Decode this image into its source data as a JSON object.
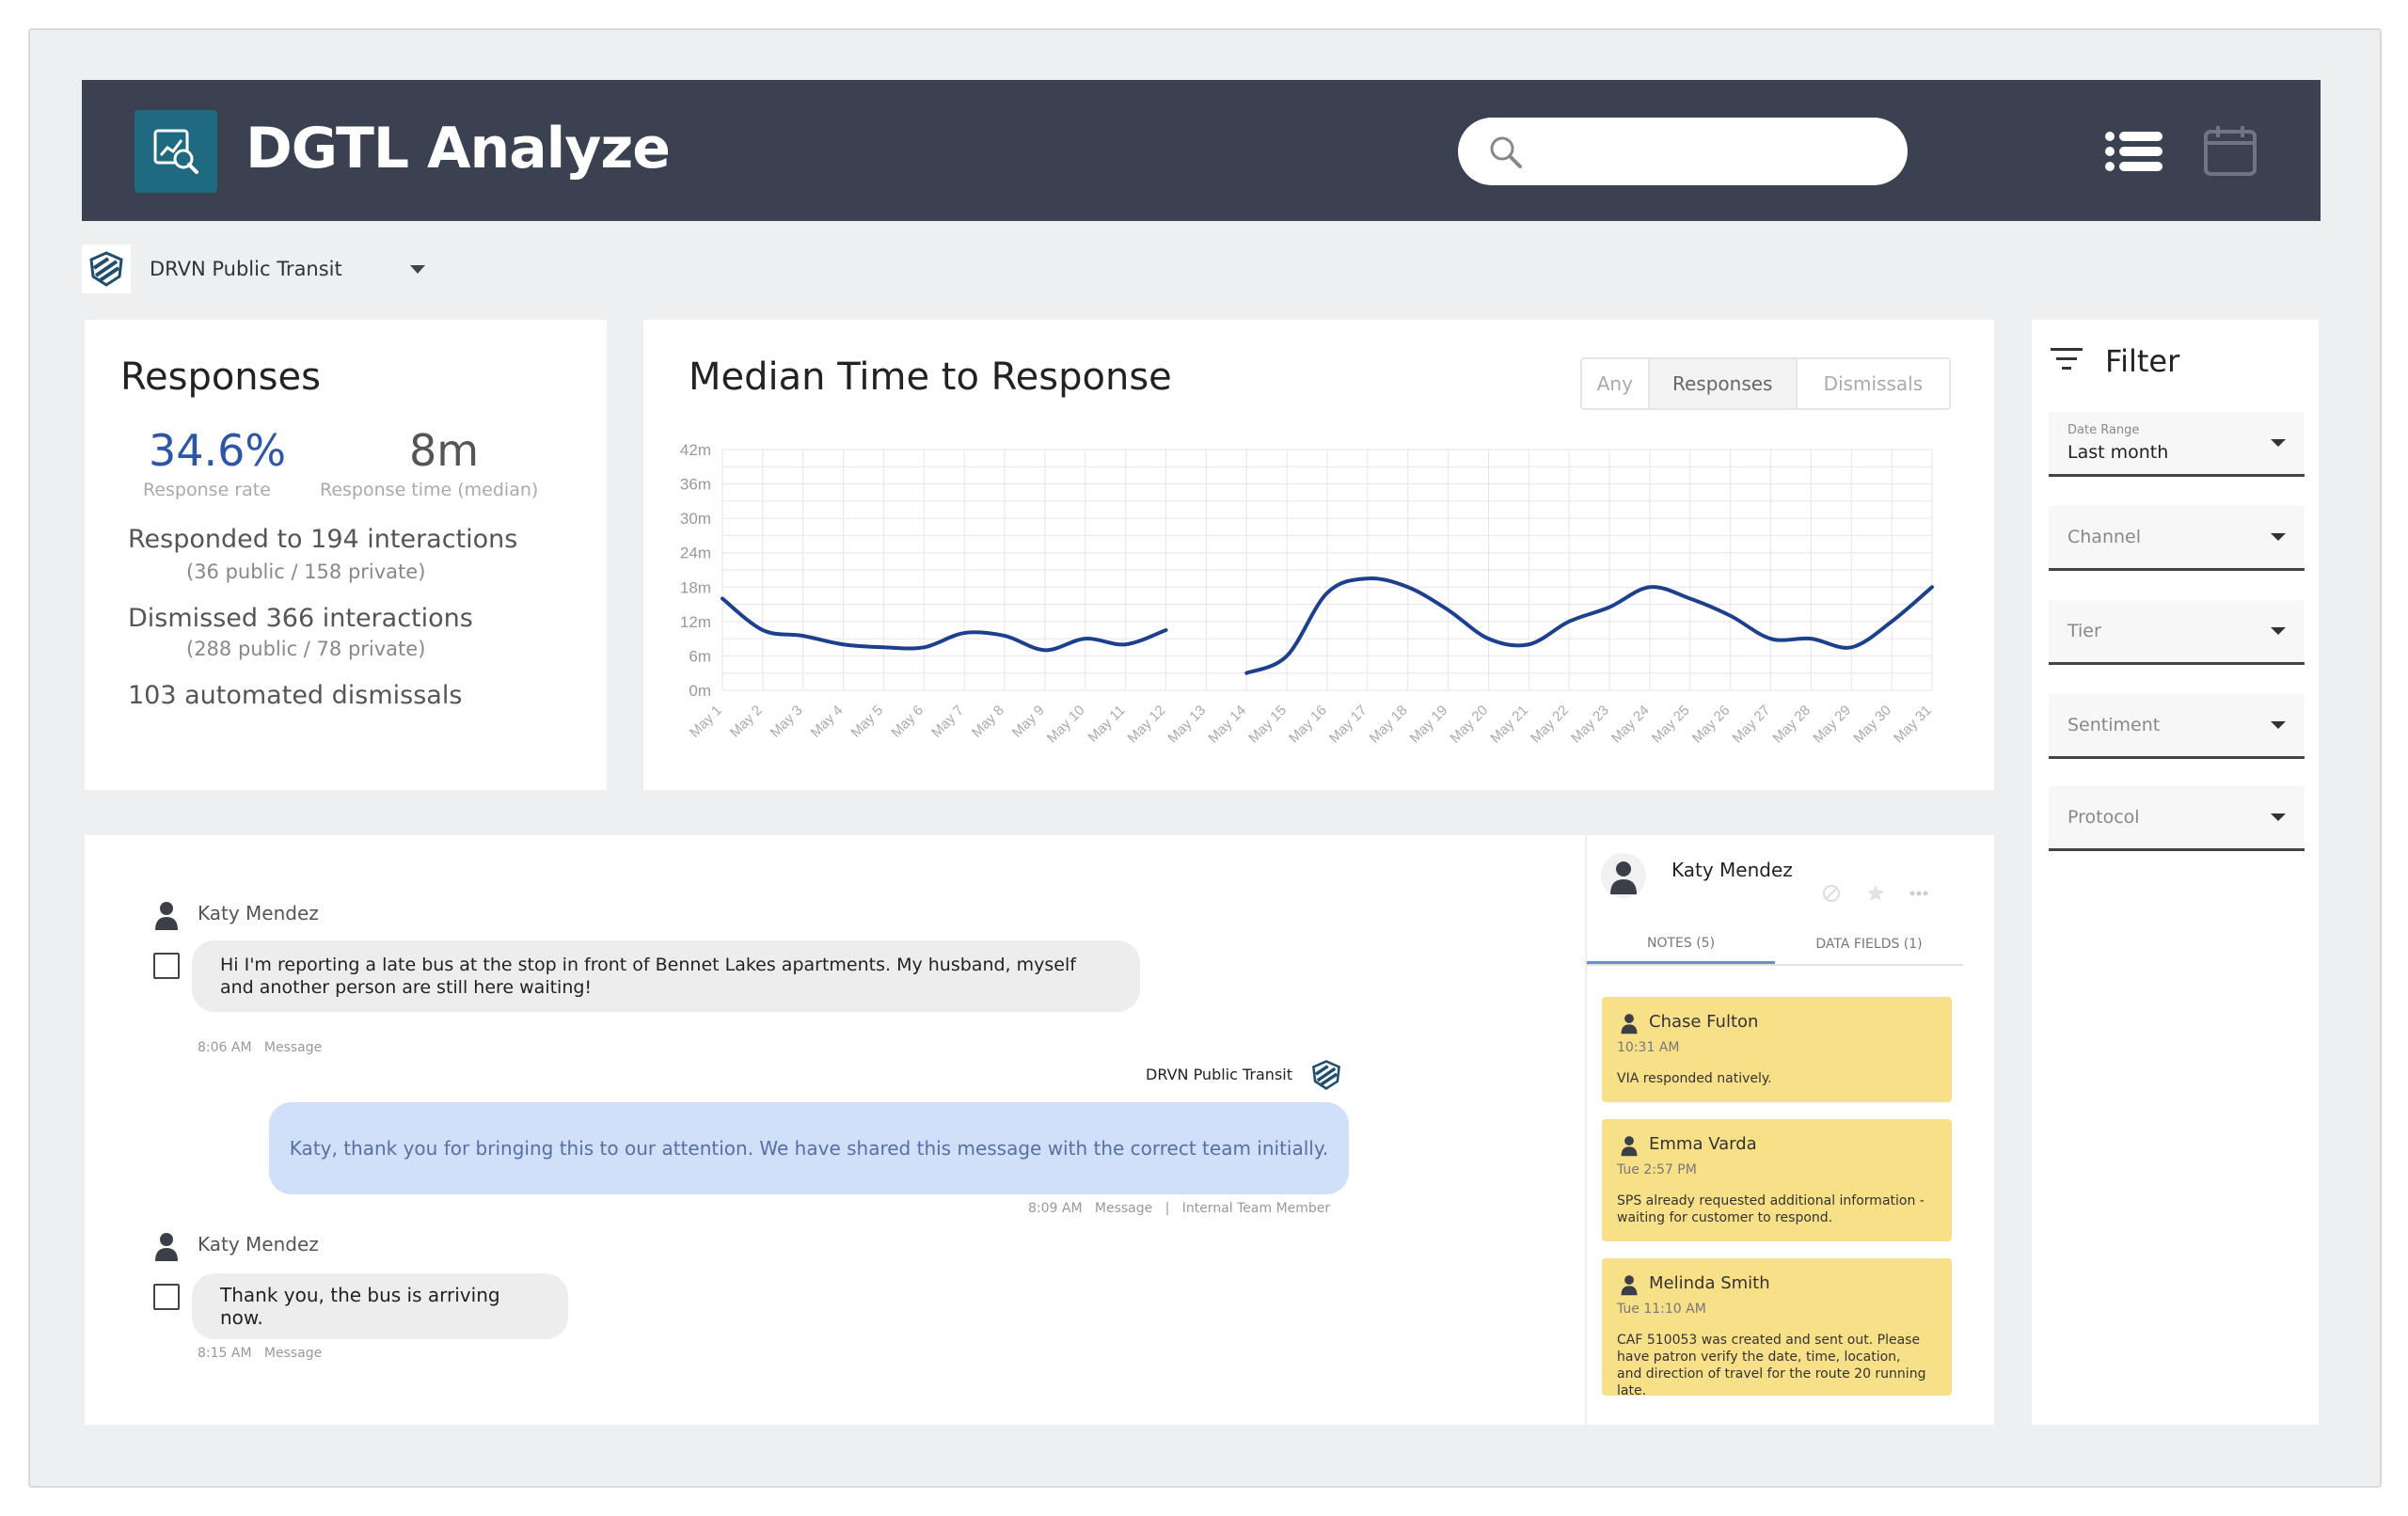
{
  "app": {
    "title": "DGTL Analyze"
  },
  "header": {
    "search": {
      "placeholder": "",
      "value": ""
    }
  },
  "org": {
    "name": "DRVN Public Transit"
  },
  "responses": {
    "title": "Responses",
    "rate_value": "34.6%",
    "rate_label": "Response rate",
    "time_value": "8m",
    "time_label": "Response time (median)",
    "responded": "Responded to 194 interactions",
    "responded_sub": "(36 public / 158 private)",
    "dismissed": "Dismissed 366 interactions",
    "dismissed_sub": "(288 public / 78 private)",
    "automated": "103 automated dismissals",
    "accent": "#2c57a7"
  },
  "median_chart": {
    "title": "Median Time to Response",
    "tabs": [
      "Any",
      "Responses",
      "Dismissals"
    ],
    "active_tab": "Responses"
  },
  "chart_data": {
    "type": "line",
    "title": "Median Time to Response",
    "x": [
      "May 1",
      "May 2",
      "May 3",
      "May 4",
      "May 5",
      "May 6",
      "May 7",
      "May 8",
      "May 9",
      "May 10",
      "May 11",
      "May 12",
      "May 13",
      "May 14",
      "May 15",
      "May 16",
      "May 17",
      "May 18",
      "May 19",
      "May 20",
      "May 21",
      "May 22",
      "May 23",
      "May 24",
      "May 25",
      "May 26",
      "May 27",
      "May 28",
      "May 29",
      "May 30",
      "May 31"
    ],
    "y_ticks": [
      "0m",
      "6m",
      "12m",
      "18m",
      "24m",
      "30m",
      "36m",
      "42m"
    ],
    "ylim": [
      0,
      42
    ],
    "series": [
      {
        "values": [
          16,
          10.5,
          9.5,
          8,
          7.5,
          7.5,
          10,
          9.5,
          7,
          9,
          8,
          10.5,
          null,
          3,
          6,
          17,
          19.5,
          18,
          14,
          9,
          8,
          12,
          14.5,
          18,
          16,
          13,
          9,
          9,
          7.5,
          12,
          18
        ],
        "color": "#1c3f8e"
      }
    ],
    "grid": true,
    "legend": "none"
  },
  "filter": {
    "title": "Filter",
    "date_range_label": "Date Range",
    "date_range_value": "Last month",
    "channel": "Channel",
    "tier": "Tier",
    "sentiment": "Sentiment",
    "protocol": "Protocol"
  },
  "conversation": {
    "messages": [
      {
        "author": "Katy Mendez",
        "text": "Hi I'm reporting a late bus at the stop in front of Bennet Lakes apartments. My husband, myself and another person are still here waiting!",
        "time": "8:06 AM",
        "type": "Message"
      },
      {
        "author": "DRVN Public Transit",
        "text": "Katy, thank you for bringing this to our attention. We have shared this message with the correct team initially.",
        "time": "8:09 AM",
        "type": "Message",
        "sep": "|",
        "role": "Internal Team Member"
      },
      {
        "author": "Katy Mendez",
        "text": "Thank you, the bus is arriving now.",
        "time": "8:15 AM",
        "type": "Message"
      }
    ]
  },
  "contact_panel": {
    "name": "Katy Mendez",
    "tabs": [
      "NOTES (5)",
      "DATA FIELDS (1)"
    ],
    "notes": [
      {
        "author": "Chase Fulton",
        "time": "10:31 AM",
        "text": "VIA responded natively."
      },
      {
        "author": "Emma Varda",
        "time": "Tue 2:57 PM",
        "text": "SPS already requested additional information - waiting for customer to respond."
      },
      {
        "author": "Melinda Smith",
        "time": "Tue 11:10 AM",
        "text": "CAF 510053 was created and sent out. Please have patron verify the date, time, location, and direction of travel for the route 20 running late."
      }
    ]
  }
}
